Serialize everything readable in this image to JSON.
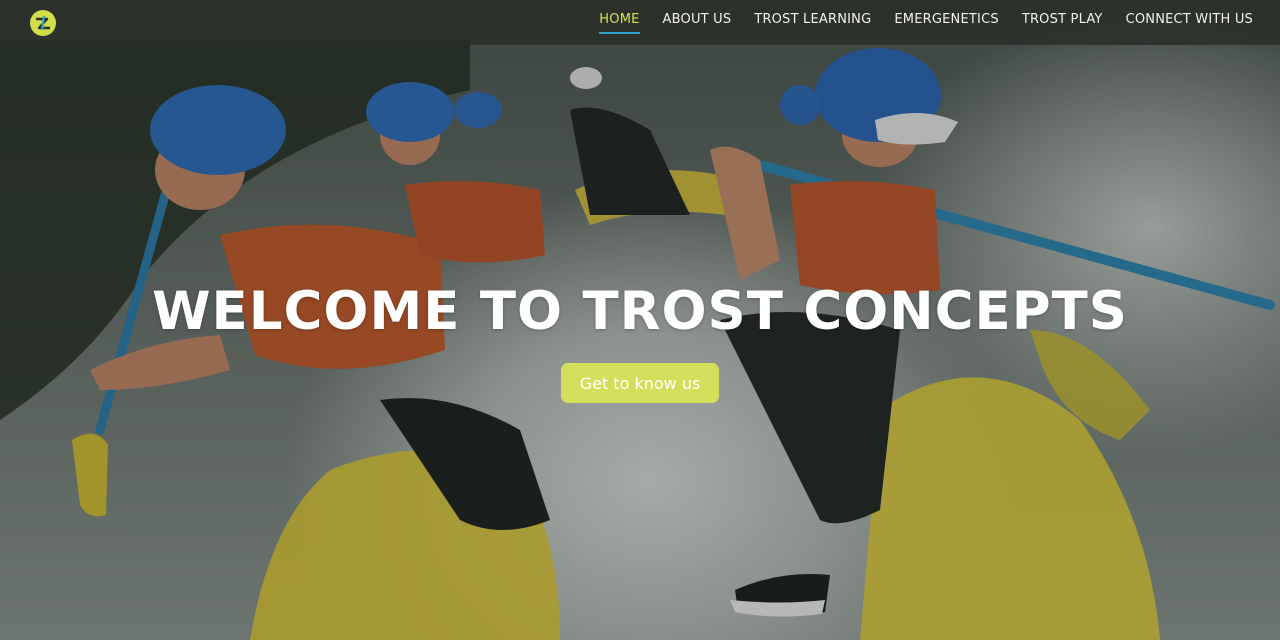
{
  "brand": {
    "logo_icon": "trost-concepts-logo-icon",
    "accent_color": "#d3de4b",
    "underline_color": "#2fa6c9"
  },
  "nav": {
    "items": [
      {
        "label": "HOME",
        "active": true
      },
      {
        "label": "ABOUT US"
      },
      {
        "label": "TROST LEARNING"
      },
      {
        "label": "EMERGENETICS"
      },
      {
        "label": "TROST PLAY"
      },
      {
        "label": "CONNECT WITH US"
      }
    ]
  },
  "hero": {
    "title": "WELCOME TO TROST CONCEPTS",
    "cta_label": "Get to know us",
    "cta_color": "#d3df5a",
    "background": "whitewater-rafting-photo"
  }
}
